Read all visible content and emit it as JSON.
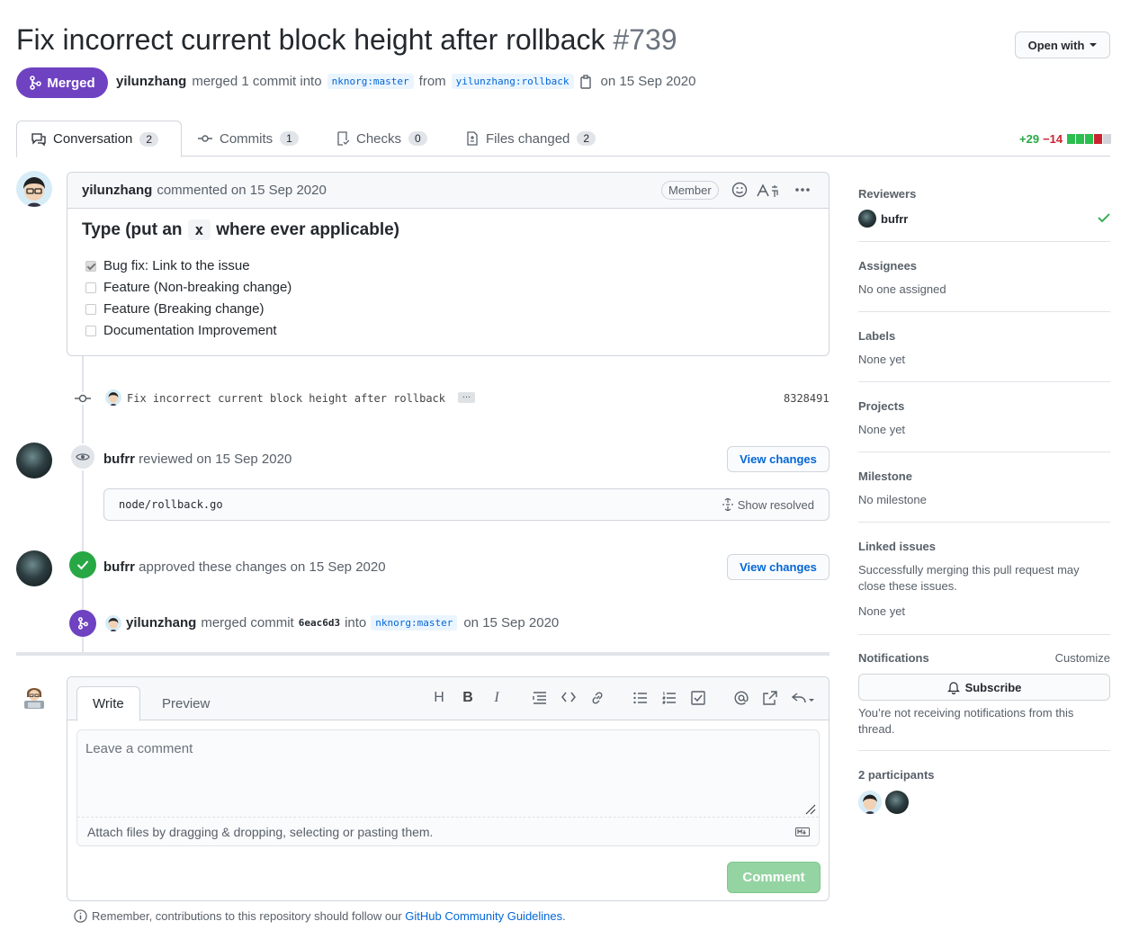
{
  "pr": {
    "title": "Fix incorrect current block height after rollback",
    "number": "#739",
    "state": "Merged",
    "author": "yilunzhang",
    "merged_text": "merged 1 commit into",
    "base_branch": "nknorg:master",
    "from_text": "from",
    "head_branch": "yilunzhang:rollback",
    "date_text": "on 15 Sep 2020"
  },
  "header": {
    "open_with_label": "Open with"
  },
  "tabs": [
    {
      "label": "Conversation",
      "count": "2"
    },
    {
      "label": "Commits",
      "count": "1"
    },
    {
      "label": "Checks",
      "count": "0"
    },
    {
      "label": "Files changed",
      "count": "2"
    }
  ],
  "diffstat": {
    "additions": "+29",
    "deletions": "−14"
  },
  "comment": {
    "author": "yilunzhang",
    "action": "commented on 15 Sep 2020",
    "role_badge": "Member",
    "heading_before": "Type (put an",
    "heading_code": "x",
    "heading_after": "where ever applicable)",
    "tasks": [
      {
        "label": "Bug fix: Link to the issue",
        "checked": true
      },
      {
        "label": "Feature (Non-breaking change)",
        "checked": false
      },
      {
        "label": "Feature (Breaking change)",
        "checked": false
      },
      {
        "label": "Documentation Improvement",
        "checked": false
      }
    ]
  },
  "commit": {
    "message": "Fix incorrect current block height after rollback",
    "ellipsis": "…",
    "sha": "8328491"
  },
  "review1": {
    "author": "bufrr",
    "action": "reviewed on 15 Sep 2020",
    "view_changes": "View changes",
    "file": "node/rollback.go",
    "show_resolved": "Show resolved"
  },
  "review2": {
    "author": "bufrr",
    "action": "approved these changes on 15 Sep 2020",
    "view_changes": "View changes"
  },
  "merge_event": {
    "author": "yilunzhang",
    "text": "merged commit",
    "sha": "6eac6d3",
    "into": "into",
    "branch": "nknorg:master",
    "date": "on 15 Sep 2020"
  },
  "editor": {
    "write_tab": "Write",
    "preview_tab": "Preview",
    "placeholder": "Leave a comment",
    "attach_text": "Attach files by dragging & dropping, selecting or pasting them.",
    "comment_button": "Comment"
  },
  "footer": {
    "remember_text": "Remember, contributions to this repository should follow our",
    "guidelines_link": "GitHub Community Guidelines",
    "period": "."
  },
  "sidebar": {
    "reviewers_title": "Reviewers",
    "reviewer_name": "bufrr",
    "assignees_title": "Assignees",
    "assignees_value": "No one assigned",
    "labels_title": "Labels",
    "labels_value": "None yet",
    "projects_title": "Projects",
    "projects_value": "None yet",
    "milestone_title": "Milestone",
    "milestone_value": "No milestone",
    "linked_title": "Linked issues",
    "linked_desc": "Successfully merging this pull request may close these issues.",
    "linked_value": "None yet",
    "notifications_title": "Notifications",
    "customize": "Customize",
    "subscribe": "Subscribe",
    "notif_desc": "You’re not receiving notifications from this thread.",
    "participants_title": "2 participants"
  },
  "colors": {
    "merged": "#6f42c1",
    "link": "#0366d6",
    "approved": "#28a745",
    "additions": "#28a745",
    "deletions": "#cb2431"
  }
}
